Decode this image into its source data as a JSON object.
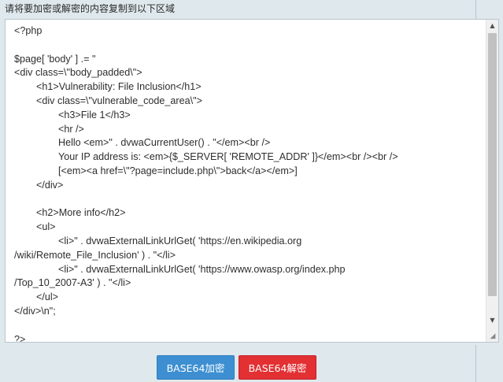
{
  "instruction": "请将要加密或解密的内容复制到以下区域",
  "editor": {
    "content": "<?php\n\n$page[ 'body' ] .= \"\n<div class=\\\"body_padded\\\">\n\t<h1>Vulnerability: File Inclusion</h1>\n\t<div class=\\\"vulnerable_code_area\\\">\n\t\t<h3>File 1</h3>\n\t\t<hr />\n\t\tHello <em>\" . dvwaCurrentUser() . \"</em><br />\n\t\tYour IP address is: <em>{$_SERVER[ 'REMOTE_ADDR' ]}</em><br /><br />\n\t\t[<em><a href=\\\"?page=include.php\\\">back</a></em>]\n\t</div>\n\n\t<h2>More info</h2>\n\t<ul>\n\t\t<li>\" . dvwaExternalLinkUrlGet( 'https://en.wikipedia.org\n/wiki/Remote_File_Inclusion' ) . \"</li>\n\t\t<li>\" . dvwaExternalLinkUrlGet( 'https://www.owasp.org/index.php\n/Top_10_2007-A3' ) . \"</li>\n\t</ul>\n</div>\\n\";\n\n?>"
  },
  "buttons": {
    "encode": "BASE64加密",
    "decode": "BASE64解密"
  },
  "colors": {
    "encode_button": "#3d8fd1",
    "decode_button": "#e23033",
    "background": "#dfe8ec"
  },
  "icons": {
    "scroll_up": "▲",
    "scroll_down": "▼",
    "resize_grip": "◢"
  }
}
